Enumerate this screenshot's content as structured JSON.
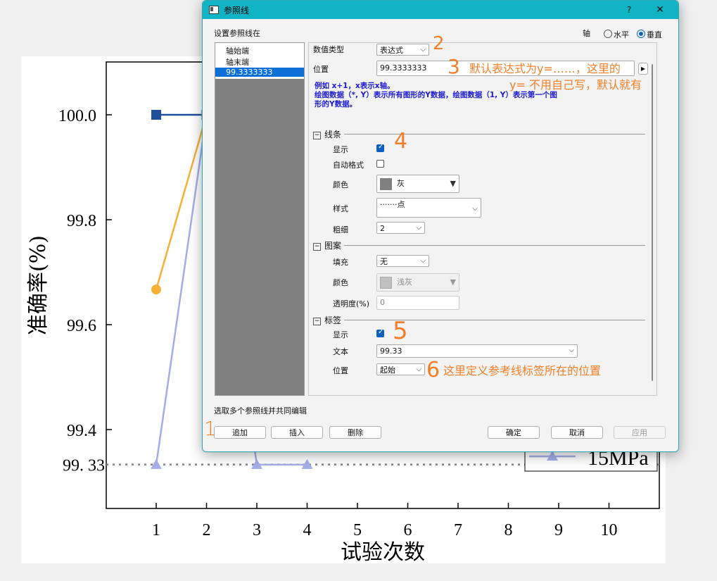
{
  "chart_data": {
    "type": "line",
    "ylabel": "准确率(%)",
    "xlabel": "试验次数",
    "x_ticks": [
      "1",
      "2",
      "3",
      "4",
      "5",
      "6",
      "7",
      "8",
      "9",
      "10"
    ],
    "y_ticks": [
      "99.4",
      "99.6",
      "99.8",
      "100.0"
    ],
    "ylim": [
      99.2,
      100.1
    ],
    "xlim": [
      0,
      11
    ],
    "reference_line": {
      "value": 99.3333333,
      "label": "99. 33",
      "style": "dotted",
      "color": "#808080"
    },
    "series": [
      {
        "name": "",
        "color": "#1f4e9a",
        "marker": "square",
        "points": [
          [
            1,
            100.0
          ],
          [
            2,
            100.0
          ]
        ]
      },
      {
        "name": "",
        "color": "#f5b035",
        "marker": "circle",
        "points": [
          [
            1,
            99.667
          ],
          [
            2,
            100.0
          ]
        ]
      },
      {
        "name": "15MPa",
        "color": "#a3aee8",
        "marker": "triangle",
        "points": [
          [
            1,
            99.333
          ],
          [
            2,
            100.0
          ],
          [
            3,
            99.333
          ],
          [
            4,
            99.333
          ]
        ]
      }
    ],
    "legend_label": "15MPa"
  },
  "dialog": {
    "title": "参照线",
    "help": "?",
    "close": "✕",
    "set_at": "设置参照线在",
    "axis_label": "轴",
    "axis_h": "水平",
    "axis_v": "垂直",
    "list_items": [
      "轴始端",
      "轴末端",
      "99.3333333"
    ],
    "value_type_label": "数值类型",
    "value_type": "表达式",
    "position_label": "位置",
    "position_value": "99.3333333",
    "hint_line1": "例如 x+1，x表示x轴。",
    "hint_line2": "绘图数据（*, Y）表示所有图形的Y数据，绘图数据（1, Y）表示第一个图",
    "hint_line3": "形的Y数据。",
    "sec_line": "线条",
    "show_label": "显示",
    "auto_format_label": "自动格式",
    "color_label": "颜色",
    "color_value": "灰",
    "style_label": "样式",
    "style_value": "·······点",
    "width_label": "粗细",
    "width_value": "2",
    "sec_pattern": "图案",
    "fill_label": "填充",
    "fill_value": "无",
    "pattern_color_label": "颜色",
    "pattern_color_value": "浅灰",
    "opacity_label": "透明度(%)",
    "opacity_value": "0",
    "sec_label": "标签",
    "label_show": "显示",
    "text_label": "文本",
    "text_value": "99.33",
    "label_pos_label": "位置",
    "label_pos_value": "起始",
    "multi_edit": "选取多个参照线并共同编辑",
    "btn_add": "追加",
    "btn_insert": "插入",
    "btn_delete": "删除",
    "btn_ok": "确定",
    "btn_cancel": "取消",
    "btn_apply": "应用",
    "colors": {
      "title_bar": "#10b4c4",
      "accent": "#0c5fc0",
      "gray": "#808080",
      "annotation": "#f07f28"
    }
  },
  "annotations": {
    "n2": "2",
    "n3": "3",
    "note3_line1": "默认表达式为y=……，这里的",
    "note3_line2": "y= 不用自己写，默认就有",
    "n4": "4",
    "n5": "5",
    "n6": "6",
    "note6": "这里定义参考线标签所在的位置",
    "n1": "1"
  }
}
